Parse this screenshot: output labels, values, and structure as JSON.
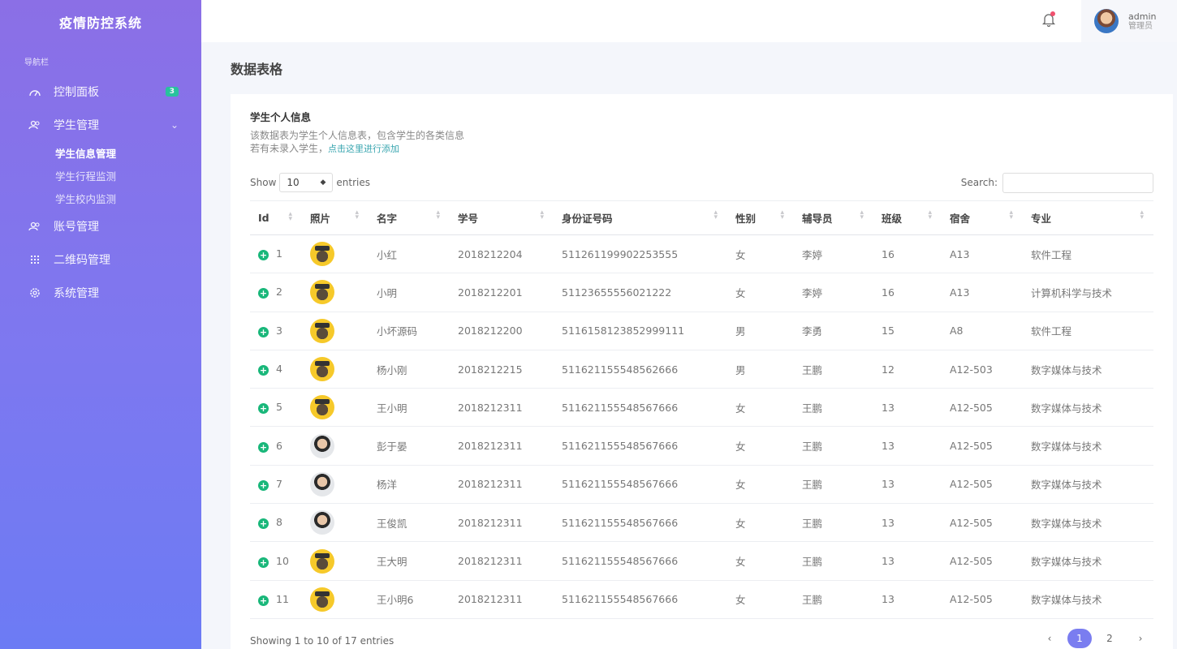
{
  "sidebar": {
    "brand": "疫情防控系统",
    "caption": "导航栏",
    "items": [
      {
        "label": "控制面板",
        "icon": "dashboard-icon",
        "badge": "3"
      },
      {
        "label": "学生管理",
        "icon": "users-icon",
        "chevron": "⌄",
        "children": [
          "学生信息管理",
          "学生行程监测",
          "学生校内监测"
        ]
      },
      {
        "label": "账号管理",
        "icon": "account-icon"
      },
      {
        "label": "二维码管理",
        "icon": "grid-icon"
      },
      {
        "label": "系统管理",
        "icon": "gear-icon"
      }
    ]
  },
  "topbar": {
    "user": {
      "name": "admin",
      "role": "管理员"
    }
  },
  "page": {
    "title": "数据表格"
  },
  "card": {
    "title": "学生个人信息",
    "desc1": "该数据表为学生个人信息表，包含学生的各类信息",
    "desc2": "若有未录入学生，",
    "link": "点击这里进行添加"
  },
  "controls": {
    "show": "Show",
    "length": "10",
    "entries": "entries",
    "search": "Search:"
  },
  "table": {
    "columns": [
      "Id",
      "照片",
      "名字",
      "学号",
      "身份证号码",
      "性别",
      "辅导员",
      "班级",
      "宿舍",
      "专业"
    ],
    "rows": [
      {
        "id": "1",
        "photo": "grad",
        "name": "小红",
        "sid": "2018212204",
        "idcard": "511261199902253555",
        "gender": "女",
        "counselor": "李婷",
        "class": "16",
        "dorm": "A13",
        "major": "软件工程"
      },
      {
        "id": "2",
        "photo": "grad",
        "name": "小明",
        "sid": "2018212201",
        "idcard": "51123655556021222",
        "gender": "女",
        "counselor": "李婷",
        "class": "16",
        "dorm": "A13",
        "major": "计算机科学与技术"
      },
      {
        "id": "3",
        "photo": "grad",
        "name": "小坏源码",
        "sid": "2018212200",
        "idcard": "5116158123852999111",
        "gender": "男",
        "counselor": "李勇",
        "class": "15",
        "dorm": "A8",
        "major": "软件工程"
      },
      {
        "id": "4",
        "photo": "grad",
        "name": "杨小刚",
        "sid": "2018212215",
        "idcard": "511621155548562666",
        "gender": "男",
        "counselor": "王鹏",
        "class": "12",
        "dorm": "A12-503",
        "major": "数字媒体与技术"
      },
      {
        "id": "5",
        "photo": "grad",
        "name": "王小明",
        "sid": "2018212311",
        "idcard": "511621155548567666",
        "gender": "女",
        "counselor": "王鹏",
        "class": "13",
        "dorm": "A12-505",
        "major": "数字媒体与技术"
      },
      {
        "id": "6",
        "photo": "real",
        "name": "彭于晏",
        "sid": "2018212311",
        "idcard": "511621155548567666",
        "gender": "女",
        "counselor": "王鹏",
        "class": "13",
        "dorm": "A12-505",
        "major": "数字媒体与技术"
      },
      {
        "id": "7",
        "photo": "real",
        "name": "杨洋",
        "sid": "2018212311",
        "idcard": "511621155548567666",
        "gender": "女",
        "counselor": "王鹏",
        "class": "13",
        "dorm": "A12-505",
        "major": "数字媒体与技术"
      },
      {
        "id": "8",
        "photo": "real",
        "name": "王俊凯",
        "sid": "2018212311",
        "idcard": "511621155548567666",
        "gender": "女",
        "counselor": "王鹏",
        "class": "13",
        "dorm": "A12-505",
        "major": "数字媒体与技术"
      },
      {
        "id": "10",
        "photo": "grad",
        "name": "王大明",
        "sid": "2018212311",
        "idcard": "511621155548567666",
        "gender": "女",
        "counselor": "王鹏",
        "class": "13",
        "dorm": "A12-505",
        "major": "数字媒体与技术"
      },
      {
        "id": "11",
        "photo": "grad",
        "name": "王小明6",
        "sid": "2018212311",
        "idcard": "511621155548567666",
        "gender": "女",
        "counselor": "王鹏",
        "class": "13",
        "dorm": "A12-505",
        "major": "数字媒体与技术"
      }
    ]
  },
  "footer": {
    "info": "Showing 1 to 10 of 17 entries",
    "prev": "‹",
    "pages": [
      "1",
      "2"
    ],
    "next": "›"
  },
  "colors": {
    "sidebar_top": "#8b6fe6",
    "sidebar_bottom": "#6c7bf4",
    "badge": "#20c997",
    "accent": "#7a7df0",
    "plus": "#19b77a"
  }
}
